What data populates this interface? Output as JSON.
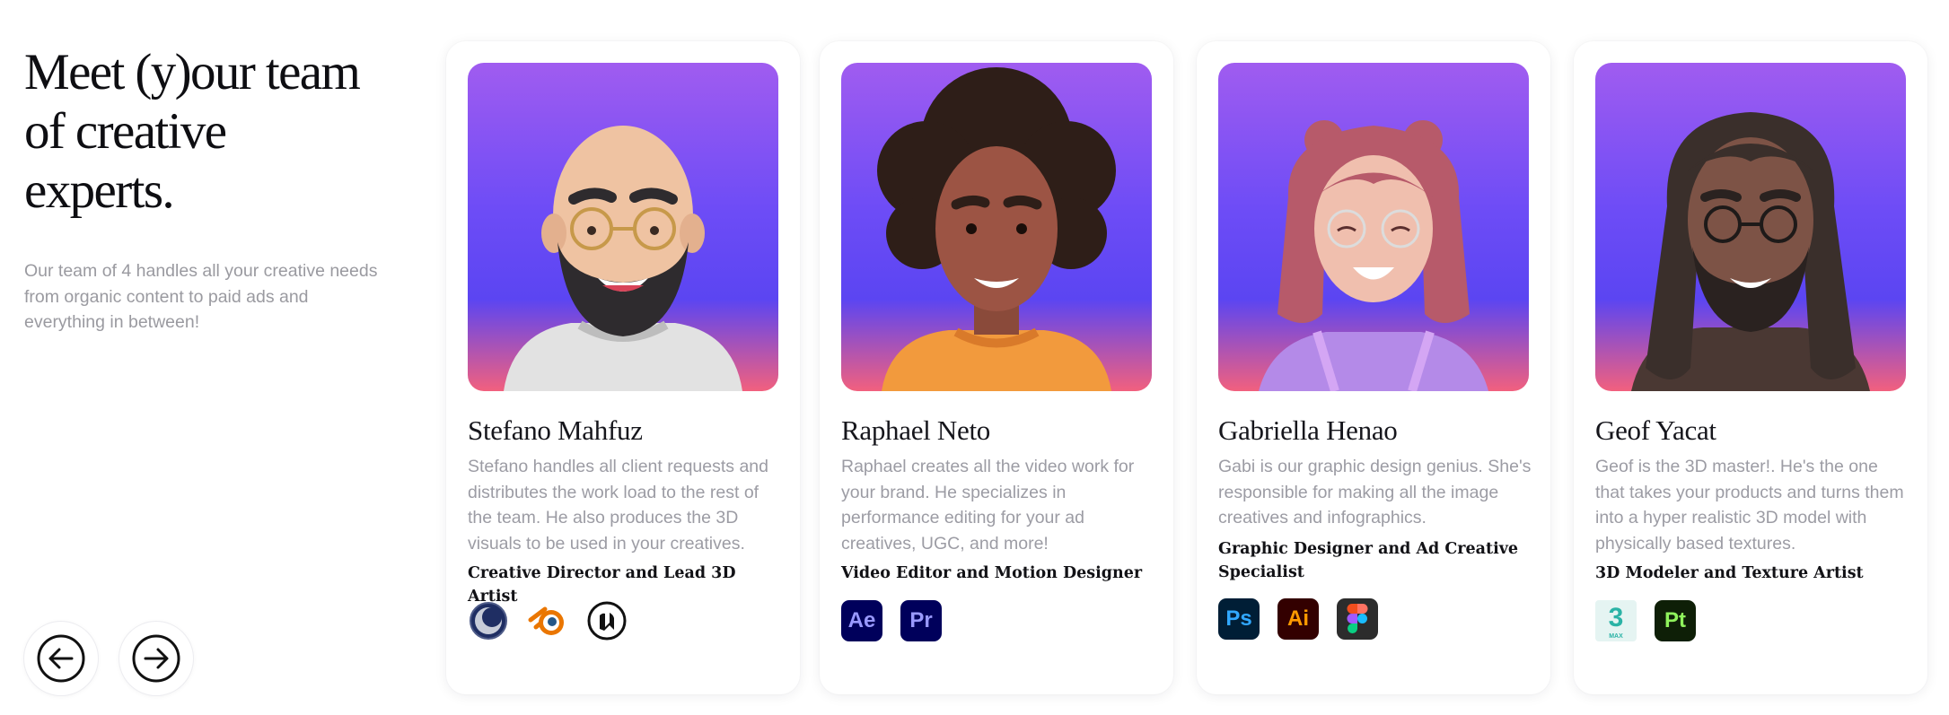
{
  "intro": {
    "title": "Meet (y)our team\nof creative experts.",
    "description": "Our team of 4 handles all your creative needs from organic content to paid ads and everything in between!"
  },
  "navigation": {
    "prev_icon": "arrow-left-icon",
    "next_icon": "arrow-right-icon"
  },
  "team": [
    {
      "name": "Stefano Mahfuz",
      "description": "Stefano handles all client requests and distributes the work load to the rest of the team. He also produces the 3D visuals to be used in your creatives.",
      "role": "Creative Director and Lead 3D Artist",
      "tools": [
        "cinema-4d-icon",
        "blender-icon",
        "unreal-engine-icon"
      ]
    },
    {
      "name": "Raphael Neto",
      "description": "Raphael creates all the video work for your brand. He specializes in performance editing for your ad creatives, UGC, and more!",
      "role": "Video Editor and Motion Designer",
      "tools": [
        "after-effects-icon",
        "premiere-pro-icon"
      ],
      "tool_labels": [
        "Ae",
        "Pr"
      ]
    },
    {
      "name": "Gabriella Henao",
      "description": "Gabi is our graphic design genius. She's responsible for making all the image creatives and infographics.",
      "role": "Graphic Designer and Ad Creative Specialist",
      "tools": [
        "photoshop-icon",
        "illustrator-icon",
        "figma-icon"
      ],
      "tool_labels": [
        "Ps",
        "Ai"
      ]
    },
    {
      "name": "Geof Yacat",
      "description": "Geof is the 3D master!. He's the one that takes your products and turns them into a hyper realistic 3D model with physically based textures.",
      "role": "3D Modeler and Texture Artist",
      "tools": [
        "3ds-max-icon",
        "substance-painter-icon"
      ],
      "tool_labels": [
        "3",
        "MAX",
        "Pt"
      ]
    }
  ],
  "colors": {
    "avatar_gradient": [
      "#a05cf0",
      "#5b45f2",
      "#f2607e"
    ],
    "after_effects": "#00005b",
    "premiere_pro": "#00005b",
    "photoshop": "#001e36",
    "illustrator": "#330000",
    "figma_bg": "#2c2c2c",
    "substance_painter": "#0e1f07"
  }
}
